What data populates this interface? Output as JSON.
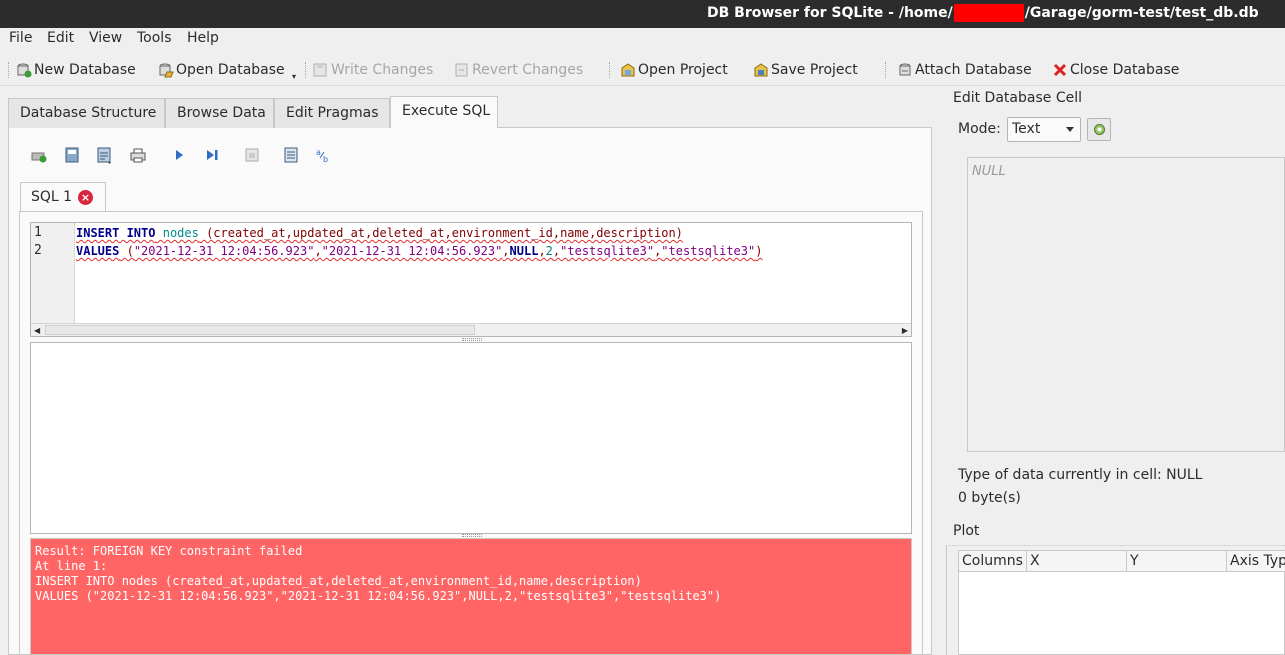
{
  "window": {
    "title_prefix": "DB Browser for SQLite - /home/",
    "title_suffix": "/Garage/gorm-test/test_db.db"
  },
  "menu": [
    "File",
    "Edit",
    "View",
    "Tools",
    "Help"
  ],
  "toolbar": {
    "new_database": "New Database",
    "open_database": "Open Database",
    "write_changes": "Write Changes",
    "revert_changes": "Revert Changes",
    "open_project": "Open Project",
    "save_project": "Save Project",
    "attach_database": "Attach Database",
    "close_database": "Close Database"
  },
  "tabs": [
    "Database Structure",
    "Browse Data",
    "Edit Pragmas",
    "Execute SQL"
  ],
  "active_tab": "Execute SQL",
  "sql_tab": {
    "label": "SQL 1",
    "close": "×"
  },
  "editor": {
    "line_numbers": [
      "1",
      "2"
    ],
    "line1": {
      "kw": "INSERT INTO",
      "table": "nodes",
      "cols": "(created_at,updated_at,deleted_at,environment_id,name,description)"
    },
    "line2": {
      "kw": "VALUES",
      "open": " (",
      "s1": "\"2021-12-31 12:04:56.923\"",
      "c1": ",",
      "s2": "\"2021-12-31 12:04:56.923\"",
      "c2": ",",
      "null": "NULL",
      "c3": ",",
      "num": "2",
      "c4": ",",
      "s3": "\"testsqlite3\"",
      "c5": ",",
      "s4": "\"testsqlite3\"",
      "close": ")"
    }
  },
  "error": {
    "lines": [
      "Result: FOREIGN KEY constraint failed",
      "At line 1:",
      "INSERT INTO nodes (created_at,updated_at,deleted_at,environment_id,name,description)",
      "VALUES (\"2021-12-31 12:04:56.923\",\"2021-12-31 12:04:56.923\",NULL,2,\"testsqlite3\",\"testsqlite3\")"
    ]
  },
  "cell_panel": {
    "title": "Edit Database Cell",
    "mode_label": "Mode:",
    "mode_value": "Text",
    "cell_value": "NULL",
    "type_info": "Type of data currently in cell: NULL",
    "size_info": "0 byte(s)"
  },
  "plot": {
    "title": "Plot",
    "headers": [
      "Columns",
      "X",
      "Y",
      "Axis Type"
    ]
  },
  "colors": {
    "error_bg": "#ff6565",
    "titlebar_bg": "#2c2c2c",
    "redaction": "#ff0000"
  }
}
